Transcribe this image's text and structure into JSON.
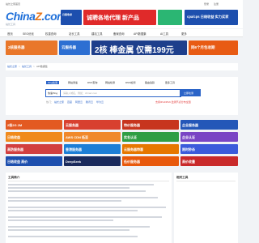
{
  "topbar": {
    "links": [
      "站长之家首页",
      "登录",
      "注册"
    ]
  },
  "brand": {
    "logo_a": "China",
    "logo_b": "Z",
    "logo_c": ".com",
    "sub": "站长工具"
  },
  "header_ads": [
    {
      "text": "诚聘各地代理 新产品",
      "color": "#e02a2a"
    },
    {
      "text": "日照收录",
      "color": "#2457b8"
    },
    {
      "text": "cpa/cps 日结收益 实力买家",
      "color": "#1d4fae"
    }
  ],
  "nav": {
    "items": [
      "首页",
      "SEO优化",
      "权重查询",
      "站长工具",
      "建站工具",
      "备案查询",
      "API数据集",
      "AI工具",
      "更多"
    ]
  },
  "banners": [
    {
      "text": "2核服务器",
      "color": "#e9772a"
    },
    {
      "text": "云服务器",
      "color": "#2d6fd2"
    },
    {
      "text": "2核 棒金属 仅需199元",
      "color": "#1e3f8c"
    },
    {
      "text": "同6个月包收期",
      "color": "#e85b14"
    }
  ],
  "breadcrumb": {
    "items": [
      "站长之家",
      "站长工具",
      "API数据集"
    ]
  },
  "search": {
    "tabs": [
      "Ping检测",
      "网站测速",
      "DNS查询",
      "网站检测",
      "DNS检测",
      "路由追踪",
      "更多工具"
    ],
    "select_label": "快速Ping",
    "placeholder": "请输入域名，例如：chinaz.com",
    "button": "立即检测",
    "hot_label": "热门：",
    "hot_links": [
      "站长之家",
      "百度",
      "阿里云",
      "腾讯云",
      "华为云"
    ],
    "note": "支持IPv4/IPv6 监测节点分布全国"
  },
  "grid_ads": [
    {
      "text": "2核2G 2M",
      "color": "#e35a22"
    },
    {
      "text": "云服务器",
      "color": "#d8402f"
    },
    {
      "text": "特价服务器",
      "color": "#c7351e"
    },
    {
      "text": "企业服务器",
      "color": "#2457b8"
    },
    {
      "text": "日结收益",
      "color": "#f08a1c"
    },
    {
      "text": "AWS CDN 低至",
      "color": "#f0892c"
    },
    {
      "text": "实名认证",
      "color": "#2f9e44"
    },
    {
      "text": "企业认证",
      "color": "#7a45c4"
    },
    {
      "text": "高防服务器",
      "color": "#d23f3f"
    },
    {
      "text": "香港服务器",
      "color": "#1c7ed6"
    },
    {
      "text": "云服务器特惠",
      "color": "#e67700"
    },
    {
      "text": "限时秒杀",
      "color": "#3b5bdb"
    },
    {
      "text": "日结收益 高价",
      "color": "#1d4fae"
    },
    {
      "text": "DeepSeek",
      "color": "#1a2a5c"
    },
    {
      "text": "低价服务器",
      "color": "#e8590c"
    },
    {
      "text": "高价收量",
      "color": "#c92a2a"
    }
  ],
  "intro": {
    "title": "工具简介",
    "side_title": "相关工具"
  }
}
